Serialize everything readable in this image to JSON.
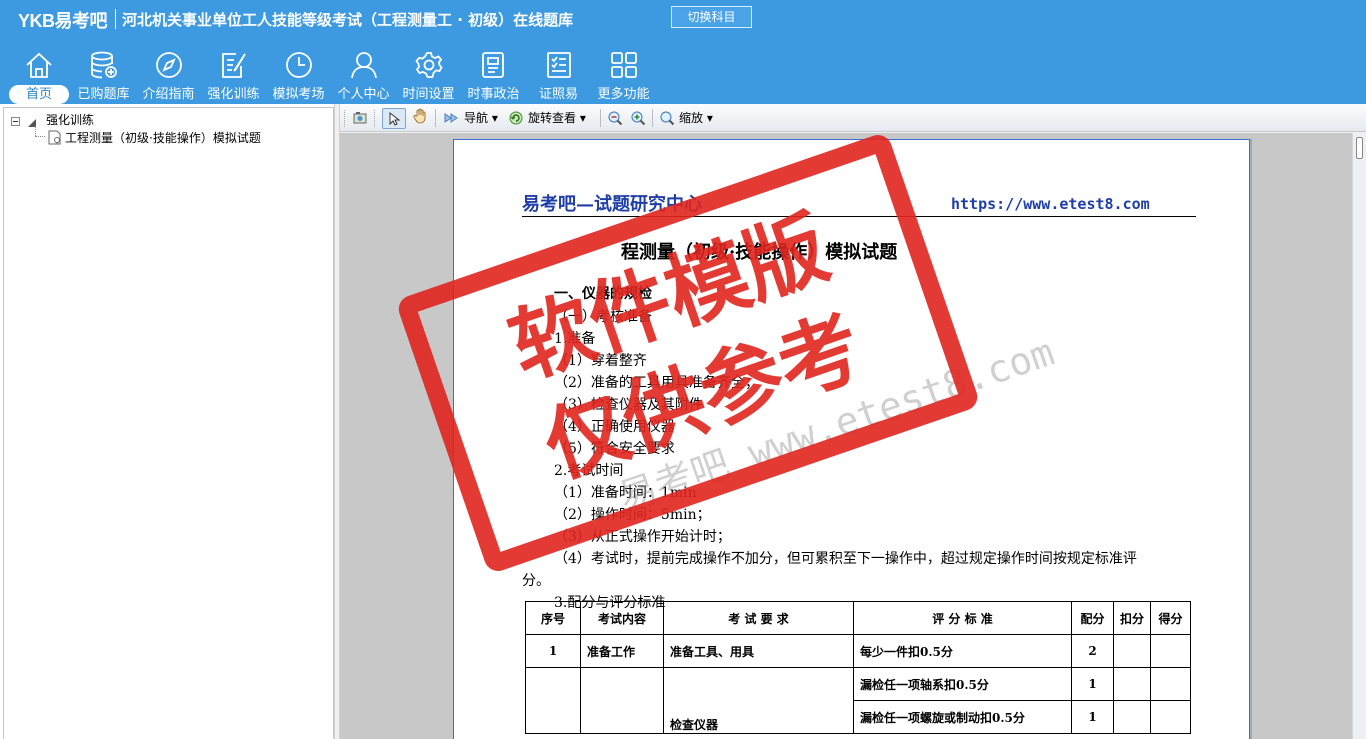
{
  "header": {
    "logo": "YKB易考吧",
    "title": "河北机关事业单位工人技能等级考试（工程测量工 · 初级）在线题库",
    "switch_button": "切换科目"
  },
  "nav": {
    "items": [
      {
        "label": "首页",
        "icon": "home-icon"
      },
      {
        "label": "已购题库",
        "icon": "database-icon"
      },
      {
        "label": "介绍指南",
        "icon": "compass-icon"
      },
      {
        "label": "强化训练",
        "icon": "edit-icon"
      },
      {
        "label": "模拟考场",
        "icon": "clock-icon"
      },
      {
        "label": "个人中心",
        "icon": "user-icon"
      },
      {
        "label": "时间设置",
        "icon": "gear-icon"
      },
      {
        "label": "时事政治",
        "icon": "news-icon"
      },
      {
        "label": "证照易",
        "icon": "certificate-icon"
      },
      {
        "label": "更多功能",
        "icon": "grid-icon"
      }
    ],
    "active_index": 0
  },
  "tree": {
    "root": "强化训练",
    "child": "工程测量（初级·技能操作）模拟试题"
  },
  "toolbar": {
    "navigate": "导航",
    "rotate": "旋转查看",
    "zoom": "缩放"
  },
  "document": {
    "header_left": "易考吧—试题研究中心",
    "header_right": "https://www.etest8.com",
    "title_visible": "程测量（初级·技能操作）模拟试题",
    "lines": [
      "一、仪器的规检",
      "（一）考核准备",
      "1.准备",
      "（1）穿着整齐",
      "（2）准备的工具用具准备齐全；",
      "（3）检查仪器及其附件",
      "（4）正确使用仪器",
      "（5）符合安全要求",
      "2.考试时间",
      "（1）准备时间：1min",
      "（2）操作时间：5min；",
      "（3）从正式操作开始计时；",
      "（4）考试时，提前完成操作不加分，但可累积至下一操作中，超过规定操作时间按规定标准评",
      "分。",
      "3.配分与评分标准"
    ],
    "table": {
      "headers": [
        "序号",
        "考试内容",
        "考 试 要 求",
        "评 分 标 准",
        "配分",
        "扣分",
        "得分"
      ],
      "rows": [
        [
          "1",
          "准备工作",
          "准备工具、用具",
          "每少一件扣0.5分",
          "2",
          "",
          ""
        ],
        [
          "",
          "",
          "",
          "漏检任一项轴系扣0.5分",
          "1",
          "",
          ""
        ],
        [
          "",
          "",
          "检查仪器",
          "漏检任一项螺旋或制动扣0.5分",
          "1",
          "",
          ""
        ]
      ]
    }
  },
  "watermark": {
    "stamp_line1": "软件模版",
    "stamp_line2": "仅供参考",
    "text": "易考吧 www.etest8.com"
  },
  "colors": {
    "topbar": "#3d9ae0",
    "stamp": "#e0251f",
    "doc_header": "#1f3ea8"
  }
}
